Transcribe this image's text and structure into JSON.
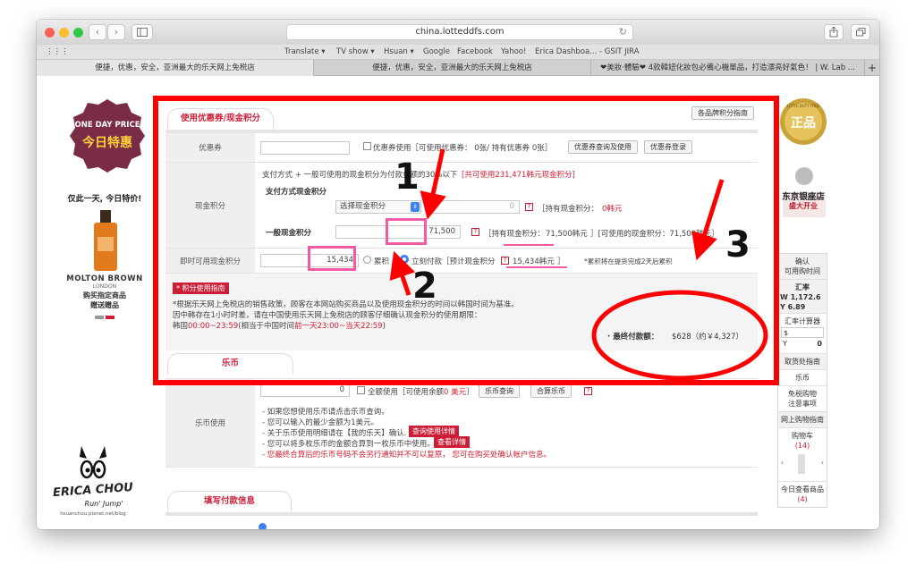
{
  "browser": {
    "url": "china.lotteddfs.com",
    "bookmarks": [
      "Translate ▾",
      "TV show ▾",
      "Hsuan ▾",
      "Google",
      "Facebook",
      "Yahoo!",
      "Erica Dashboa... - GSIT JIRA"
    ],
    "tabs": [
      "便捷，优惠，安全，亚洲最大的乐天网上免税店",
      "便捷，优惠，安全，亚洲最大的乐天网上免税店",
      "❤美妝‧體驗❤ 4款韓妞化妝包必備心機單品，打造漂亮好氣色！ | W. Lab ..."
    ]
  },
  "left_ads": {
    "oneday_top": "ONE DAY PRICE",
    "oneday_main": "今日特惠",
    "oneday_caption": "仅此一天, 今日特价!",
    "brand_name": "MOLTON BROWN",
    "brand_sub": "LONDON",
    "brand_promo_1": "购买指定商品",
    "brand_promo_2": "赠送赠品"
  },
  "coupon_section": {
    "tab_label": "使用优惠券/现金积分",
    "brand_button": "各品牌积分指南",
    "coupon": {
      "label": "优惠券",
      "checkbox_text": "优惠券使用［可使用优惠券： 0张/ 持有优惠券 0张］",
      "btn_search": "优惠券查询及使用",
      "btn_register": "优惠券登录"
    },
    "points": {
      "label": "现金积分",
      "desc": "支付方式 + 一般可使用的现金积分为付款金额的30%以下",
      "desc_red": "[共可使用231,471韩元现金积分]",
      "pay_label": "支付方式现金积分",
      "select_value": "选择现金积分",
      "pay_value": "0",
      "pay_hold_label": "［持有现金积分：",
      "pay_hold_value": "0韩元",
      "general_label": "一般现金积分",
      "general_value": "71,500",
      "general_hold": "［持有现金积分：",
      "general_hold_value": "71,500韩元",
      "general_usable": "］[可使用的现金积分：71,500韩元］"
    },
    "instant": {
      "label": "即时可用现金积分",
      "value": "15,434",
      "opt_accumulate": "累积",
      "opt_immediate": "立刻付款［预计现金积分",
      "expected_value": "15,434韩元",
      "expected_close": "］",
      "note": "*累积将在提货完成2天后累积"
    },
    "guide": {
      "tag": "* 积分使用指南",
      "line1": "*根据乐天网上免税店的销售政策，顾客在本网站购买商品以及使用现金积分的时间以韩国时间为基准。",
      "line2": "因中韩存在1小时时差，请在中国使用乐天网上免税店的顾客仔细确认现金积分的使用期限：",
      "line3_a": "韩国",
      "line3_b": "00:00~23:59",
      "line3_c": "(相当于中国时间",
      "line3_d": "前一天23:00~当天22:59",
      "line3_e": ")"
    },
    "final": {
      "label": "· 最终付款额：",
      "value": "$628（约￥4,327）"
    }
  },
  "lebi_section": {
    "tab_label": "乐币",
    "label": "乐币使用",
    "input_value": "0",
    "all_use": "全额使用［可使用余额",
    "all_use_red": "0 美元",
    "all_use_close": "］",
    "btn_search": "乐币查询",
    "btn_merge": "合算乐币",
    "notes": [
      "- 如果您想使用乐币请点击乐币查询。",
      "- 您可以输入的最少金额为1美元。",
      "- 关于乐币使用明细请在【我的乐天】确认.",
      "- 您可以将多枚乐币的金额合算到一枚乐币中使用。",
      "- 您最终合算后的乐币号码不会另行通知并不可以复原， 您可在购买处确认帐户信息。"
    ],
    "btn_detail": "查询使用详情",
    "btn_view": "查看详情"
  },
  "payment_section": {
    "tab_label": "填写付款信息"
  },
  "annotations": {
    "num1": "1",
    "num2": "2",
    "num3": "3"
  },
  "right_panel": {
    "badge_top": "LOTTE DUTY FREE",
    "badge_main": "正品",
    "store_line1": "东京银座店",
    "store_line2": "盛大开业",
    "items": [
      {
        "text": "确认\n可用购时间",
        "gray": true
      },
      {
        "text": "汇率",
        "gray": true
      },
      {
        "text": "汇率计算器",
        "gray": false
      },
      {
        "text": "取货处指南",
        "gray": true
      },
      {
        "text": "乐币",
        "gray": false
      },
      {
        "text": "免税购物\n注意事项",
        "gray": false
      },
      {
        "text": "网上购物指南",
        "gray": true
      },
      {
        "text": "购物车",
        "gray": false
      },
      {
        "text": "今日查看商品",
        "gray": false
      }
    ],
    "rate_w": "W 1,172.6",
    "rate_y": "Y 6.89",
    "calc_usd": "$",
    "calc_cny": "Y",
    "calc_cny_value": "0",
    "cart_count": "(14)",
    "viewed_count": "(4)"
  },
  "watermark": {
    "name": "ERICA CHOU",
    "tagline": "Run' Jump'",
    "url": "hsuanchou.pixnet.net/blog"
  },
  "colors": {
    "accent": "#cc1f37",
    "annotation_red": "#ff0000",
    "highlight_pink": "#f25aa6"
  }
}
